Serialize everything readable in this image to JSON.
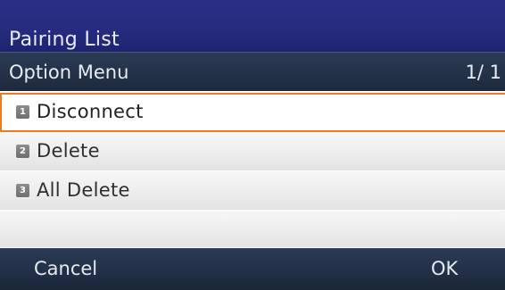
{
  "header": {
    "title": "Pairing List"
  },
  "menu": {
    "label": "Option Menu",
    "page": "1/ 1"
  },
  "items": [
    {
      "number": "1",
      "label": "Disconnect",
      "selected": true
    },
    {
      "number": "2",
      "label": "Delete",
      "selected": false
    },
    {
      "number": "3",
      "label": "All Delete",
      "selected": false
    }
  ],
  "softkeys": {
    "left": "Cancel",
    "right": "OK"
  },
  "colors": {
    "title_band": "#262b7e",
    "menu_band": "#243248",
    "selection_border": "#f07a1e",
    "row_fill": "#ededed"
  }
}
